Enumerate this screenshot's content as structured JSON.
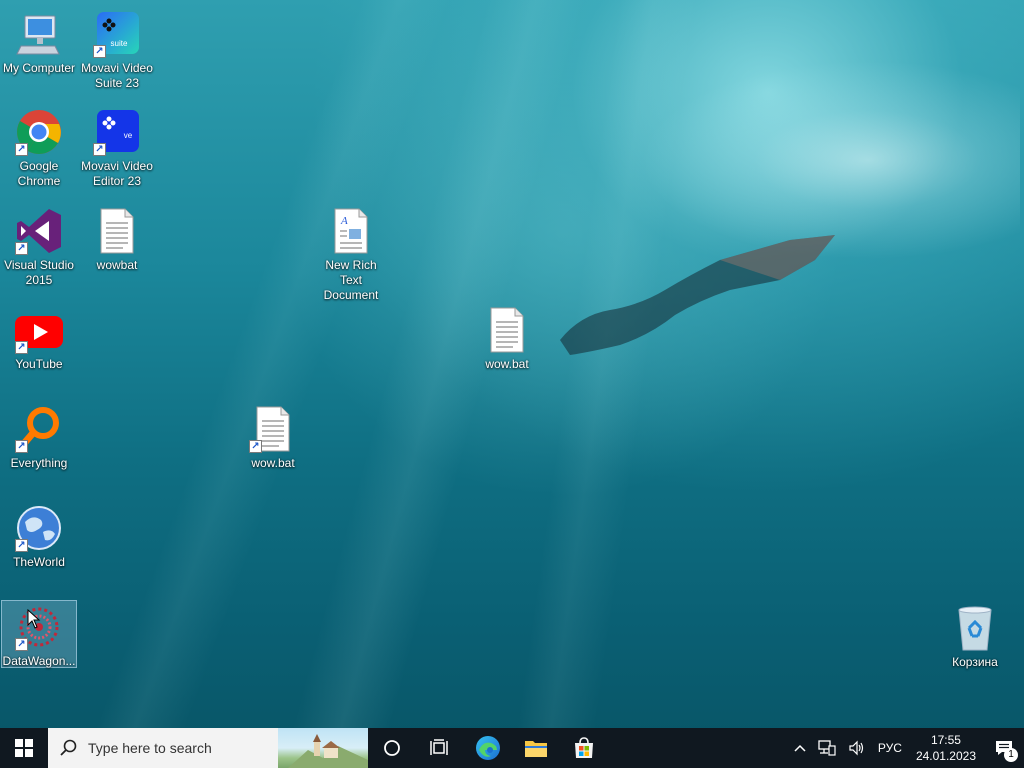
{
  "desktop": {
    "icons": [
      {
        "label": "My Computer"
      },
      {
        "label": "Movavi Video Suite 23"
      },
      {
        "label": "Google Chrome"
      },
      {
        "label": "Movavi Video Editor 23"
      },
      {
        "label": "Visual Studio 2015"
      },
      {
        "label": "wowbat"
      },
      {
        "label": "New Rich Text Document"
      },
      {
        "label": "YouTube"
      },
      {
        "label": "wow.bat"
      },
      {
        "label": "Everything"
      },
      {
        "label": "wow.bat"
      },
      {
        "label": "TheWorld"
      },
      {
        "label": "DataWagon..."
      },
      {
        "label": "Корзина"
      }
    ],
    "movavi_suite_badge": "suite",
    "movavi_editor_badge": "ve"
  },
  "taskbar": {
    "search_placeholder": "Type here to search",
    "language": "РУС",
    "time": "17:55",
    "date": "24.01.2023",
    "notification_count": "1"
  }
}
